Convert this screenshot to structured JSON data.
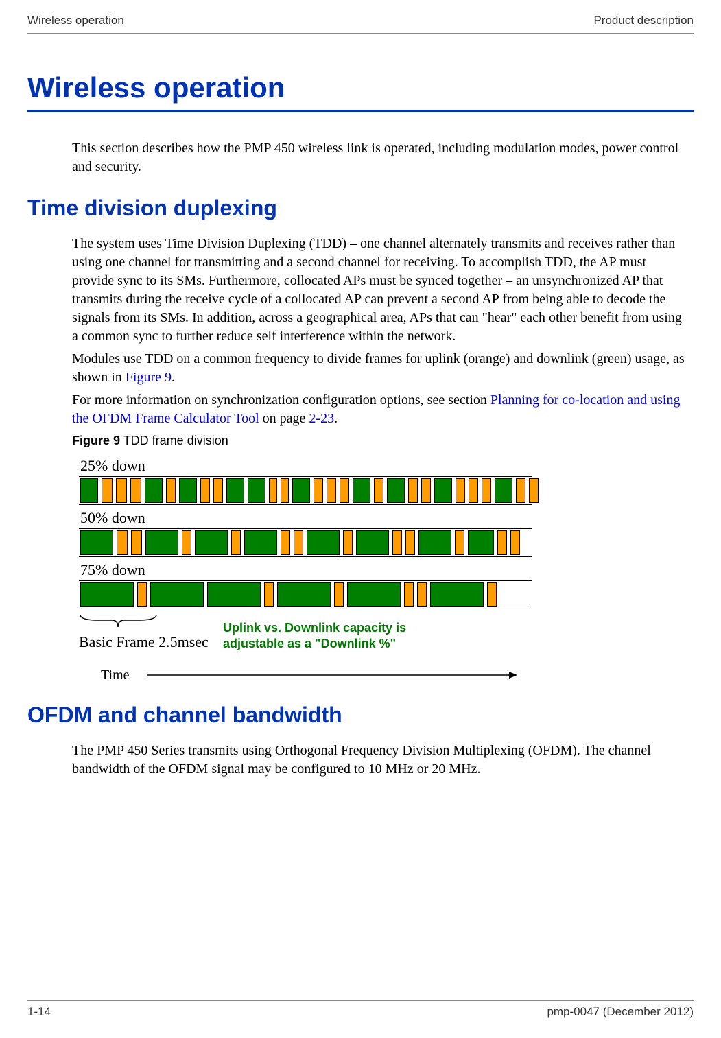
{
  "header": {
    "left": "Wireless operation",
    "right": "Product description"
  },
  "h1": "Wireless operation",
  "intro": "This section describes how the PMP 450 wireless link is operated, including modulation modes, power control and security.",
  "tdd": {
    "heading": "Time division duplexing",
    "p1": "The system uses Time Division Duplexing (TDD) – one channel alternately transmits and receives rather than using one channel for transmitting and a second channel for receiving.  To accomplish TDD, the AP must provide sync to its SMs.  Furthermore, collocated APs must be synced together – an unsynchronized AP that transmits during the receive cycle of a collocated AP can prevent a second AP from being able to decode the signals from its SMs.  In addition, across a geographical area, APs that can \"hear\" each other benefit from using a common sync to further reduce self interference within the network.",
    "p2_a": "Modules use TDD on a common frequency to divide frames for uplink (orange) and downlink (green) usage, as shown in ",
    "p2_link": "Figure 9",
    "p2_b": ".",
    "p3_a": "For more information on synchronization configuration options, see section ",
    "p3_link1": "Planning for co-location and using the OFDM Frame Calculator Tool",
    "p3_b": " on page ",
    "p3_link2": "2-23",
    "p3_c": "."
  },
  "figure": {
    "caption_bold": "Figure 9",
    "caption_rest": "  TDD frame division",
    "row1_label": "25% down",
    "row2_label": "50% down",
    "row3_label": "75% down",
    "basic_frame": "Basic Frame 2.5msec",
    "uplink_line1": "Uplink vs. Downlink capacity is",
    "uplink_line2": "adjustable as a \"Downlink %\"",
    "time_label": "Time"
  },
  "chart_data": {
    "type": "bar",
    "title": "TDD frame division",
    "xlabel": "Time",
    "series": [
      {
        "name": "25% down",
        "downlink_percent": 25,
        "uplink_percent": 75
      },
      {
        "name": "50% down",
        "downlink_percent": 50,
        "uplink_percent": 50
      },
      {
        "name": "75% down",
        "downlink_percent": 75,
        "uplink_percent": 25
      }
    ],
    "legend": {
      "downlink": "green",
      "uplink": "orange"
    },
    "basic_frame_msec": 2.5
  },
  "ofdm": {
    "heading": "OFDM and channel bandwidth",
    "p1": "The PMP 450 Series transmits using Orthogonal Frequency Division Multiplexing (OFDM).  The channel bandwidth of the OFDM signal may be configured to 10 MHz or 20 MHz."
  },
  "footer": {
    "left": "1-14",
    "right": "pmp-0047 (December 2012)"
  }
}
